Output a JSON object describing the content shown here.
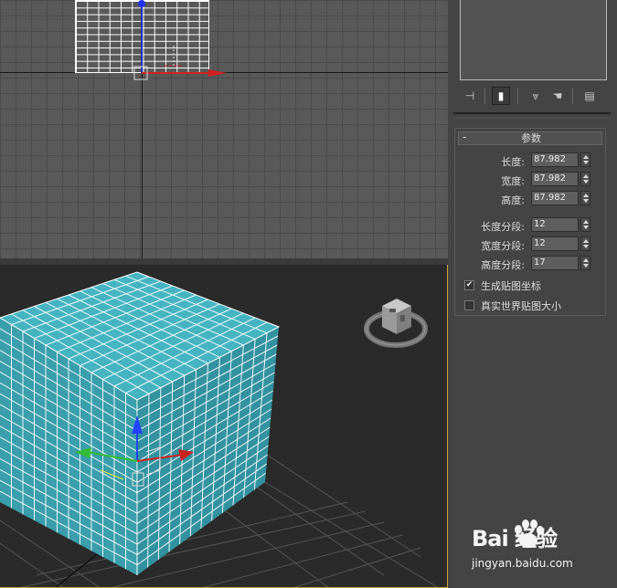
{
  "command_panel": {
    "tabs": [
      {
        "icon": "pin-icon",
        "glyph": "⊣"
      },
      {
        "icon": "modify-icon",
        "glyph": "▮"
      },
      {
        "icon": "vertex-icon",
        "glyph": "⩔"
      },
      {
        "icon": "hand-icon",
        "glyph": "☚"
      },
      {
        "icon": "configure-icon",
        "glyph": "▤"
      }
    ],
    "rollout": {
      "toggle": "-",
      "title": "参数",
      "fields": [
        {
          "label": "长度:",
          "value": "87.982"
        },
        {
          "label": "宽度:",
          "value": "87.982"
        },
        {
          "label": "高度:",
          "value": "87.982"
        },
        {
          "label": "长度分段:",
          "value": "12"
        },
        {
          "label": "宽度分段:",
          "value": "12"
        },
        {
          "label": "高度分段:",
          "value": "17"
        }
      ],
      "checkboxes": [
        {
          "label": "生成贴图坐标",
          "checked": true,
          "mark": "✔"
        },
        {
          "label": "真实世界贴图大小",
          "checked": false,
          "mark": ""
        }
      ]
    }
  },
  "viewport": {
    "object_color": "#3ea8b4",
    "active_border_color": "#c9a23a"
  },
  "watermark": {
    "logo": "Bai 经验",
    "site": "jingyan.baidu.com"
  }
}
